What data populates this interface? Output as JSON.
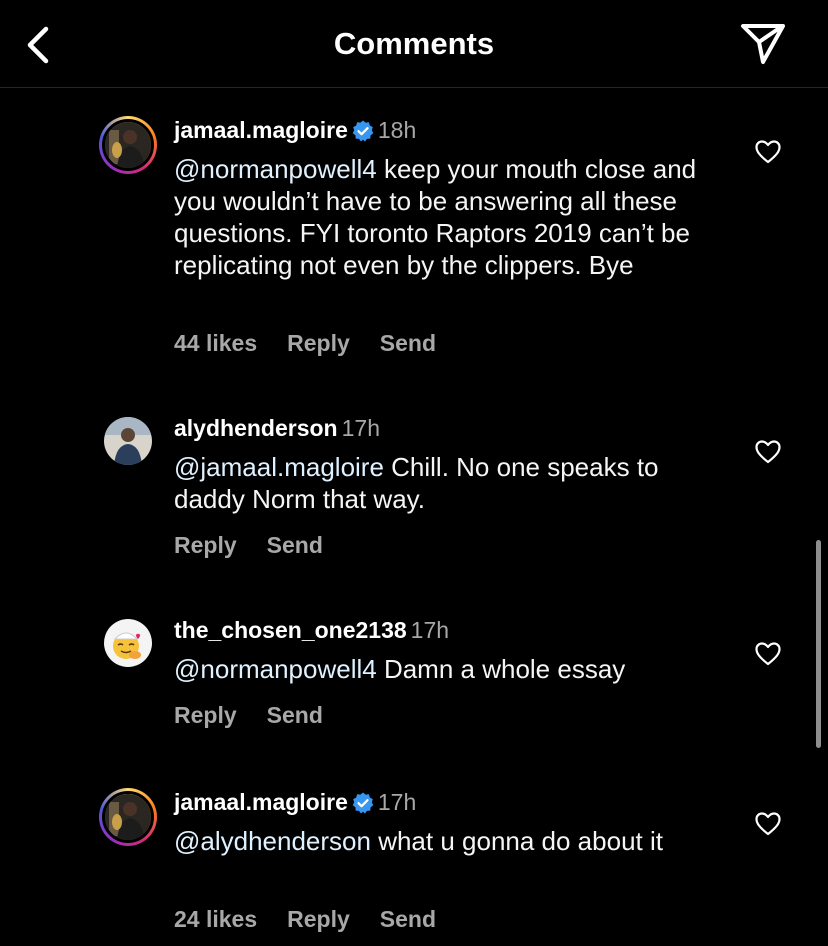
{
  "header": {
    "title": "Comments",
    "back_icon": "chevron-left-icon",
    "send_icon": "paper-plane-icon"
  },
  "comments": [
    {
      "username": "jamaal.magloire",
      "verified": true,
      "time": "18h",
      "mention": "@normanpowell4",
      "text": " keep your mouth close and you wouldn’t have to be answering all these questions. FYI toronto Raptors 2019 can’t be replicating not even by the clippers. Bye",
      "likes": "44 likes",
      "reply": "Reply",
      "send": "Send"
    },
    {
      "username": "alydhenderson",
      "verified": false,
      "time": "17h",
      "mention": "@jamaal.magloire",
      "text": " Chill. No one speaks to daddy Norm that way.",
      "reply": "Reply",
      "send": "Send"
    },
    {
      "username": "the_chosen_one2138",
      "verified": false,
      "time": "17h",
      "mention": "@normanpowell4",
      "text": " Damn a whole essay",
      "reply": "Reply",
      "send": "Send"
    },
    {
      "username": "jamaal.magloire",
      "verified": true,
      "time": "17h",
      "mention": "@alydhenderson",
      "text": " what u gonna do about it",
      "likes": "24 likes",
      "reply": "Reply",
      "send": "Send"
    }
  ],
  "colors": {
    "background": "#000000",
    "text": "#f5f5f5",
    "muted": "#a8a8a8",
    "verified": "#3797f0"
  }
}
